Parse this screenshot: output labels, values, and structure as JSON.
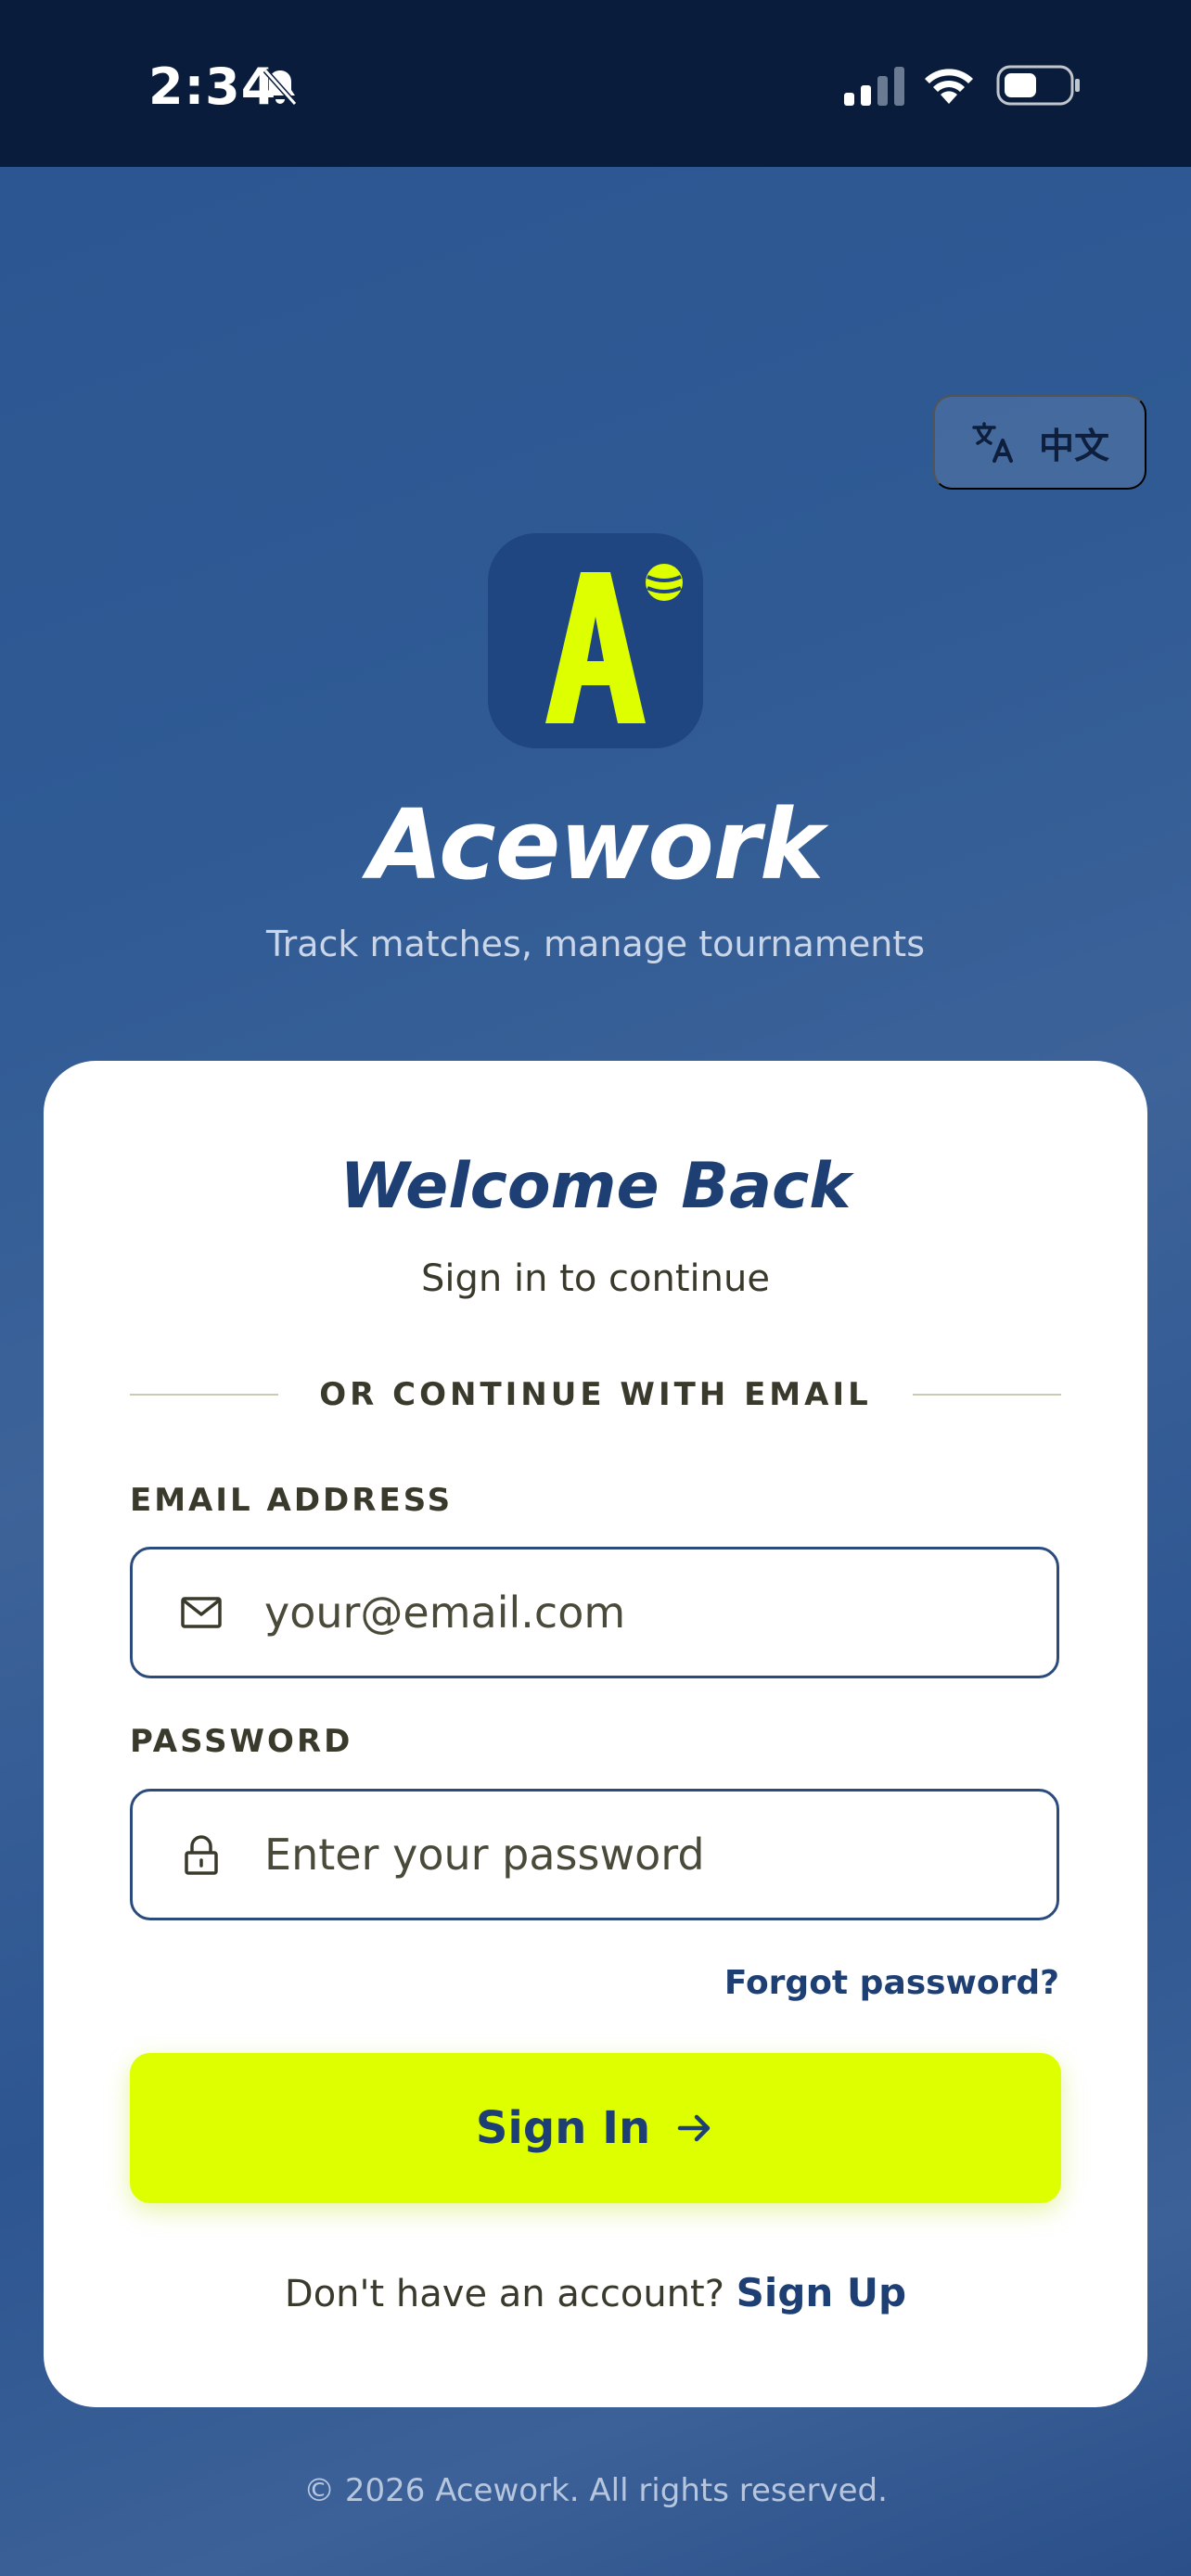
{
  "status_bar": {
    "time": "2:34",
    "icons": [
      "bell-slash-icon",
      "signal-icon",
      "wifi-icon",
      "battery-icon"
    ]
  },
  "language_button": {
    "label": "中文",
    "icon": "translate-icon"
  },
  "brand": {
    "logo_letter": "A",
    "app_name": "Acework",
    "tagline": "Track matches, manage tournaments"
  },
  "card": {
    "title": "Welcome Back",
    "subtitle": "Sign in to continue",
    "divider_text": "OR CONTINUE WITH EMAIL",
    "email": {
      "label": "EMAIL ADDRESS",
      "placeholder": "your@email.com",
      "value": "",
      "icon": "mail-icon"
    },
    "password": {
      "label": "PASSWORD",
      "placeholder": "Enter your password",
      "value": "",
      "icon": "lock-icon"
    },
    "forgot_password": "Forgot password?",
    "sign_in_button": "Sign In",
    "signup_prompt": "Don't have an account?",
    "signup_link": "Sign Up"
  },
  "footer": {
    "copyright": "© 2026 Acework. All rights reserved."
  },
  "colors": {
    "background": "#2f5a94",
    "status_bar": "#0a1c3b",
    "accent": "#deff00",
    "primary_text": "#1e3f73",
    "logo_bg": "#1f4680"
  }
}
